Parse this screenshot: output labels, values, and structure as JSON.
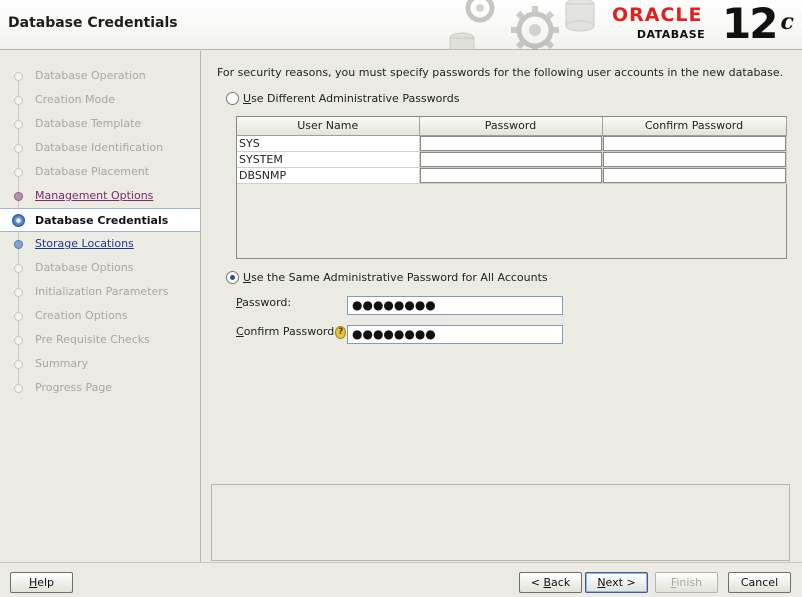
{
  "header": {
    "title": "Database Credentials",
    "brand_name": "ORACLE",
    "brand_product": "DATABASE",
    "version_number": "12",
    "version_suffix": "c"
  },
  "sidebar": {
    "steps": [
      {
        "label": "Database Operation",
        "state": "done"
      },
      {
        "label": "Creation Mode",
        "state": "done"
      },
      {
        "label": "Database Template",
        "state": "done"
      },
      {
        "label": "Database Identification",
        "state": "done"
      },
      {
        "label": "Database Placement",
        "state": "done"
      },
      {
        "label": "Management Options",
        "state": "visited"
      },
      {
        "label": "Database Credentials",
        "state": "current"
      },
      {
        "label": "Storage Locations",
        "state": "link"
      },
      {
        "label": "Database Options",
        "state": "pending"
      },
      {
        "label": "Initialization Parameters",
        "state": "pending"
      },
      {
        "label": "Creation Options",
        "state": "pending"
      },
      {
        "label": "Pre Requisite Checks",
        "state": "pending"
      },
      {
        "label": "Summary",
        "state": "pending"
      },
      {
        "label": "Progress Page",
        "state": "pending"
      }
    ]
  },
  "main": {
    "intro": "For security reasons, you must specify passwords for the following user accounts in the new database.",
    "option_different": {
      "mnemonic": "U",
      "rest": "se Different Administrative Passwords",
      "selected": false
    },
    "table": {
      "columns": [
        "User Name",
        "Password",
        "Confirm Password"
      ],
      "rows": [
        {
          "user": "SYS",
          "password": "",
          "confirm": ""
        },
        {
          "user": "SYSTEM",
          "password": "",
          "confirm": ""
        },
        {
          "user": "DBSNMP",
          "password": "",
          "confirm": ""
        }
      ]
    },
    "option_same": {
      "mnemonic": "U",
      "rest": "se the Same Administrative Password for All Accounts",
      "selected": true
    },
    "password": {
      "mnemonic": "P",
      "rest": "assword:",
      "value": "●●●●●●●●"
    },
    "confirm_password": {
      "mnemonic": "C",
      "rest": "onfirm Password",
      "help_glyph": "?",
      "value": "●●●●●●●●"
    }
  },
  "footer": {
    "help": {
      "mnemonic": "H",
      "rest": "elp"
    },
    "back": {
      "prefix": "< ",
      "mnemonic": "B",
      "rest": "ack"
    },
    "next": {
      "mnemonic": "N",
      "rest": "ext >"
    },
    "finish": {
      "mnemonic": "F",
      "rest": "inish"
    },
    "cancel": {
      "label": "Cancel"
    }
  },
  "colors": {
    "oracle_red": "#e2211c",
    "visited_link": "#7a2b6a",
    "link": "#1d3b8c",
    "panel_bg": "#ebebe4"
  }
}
